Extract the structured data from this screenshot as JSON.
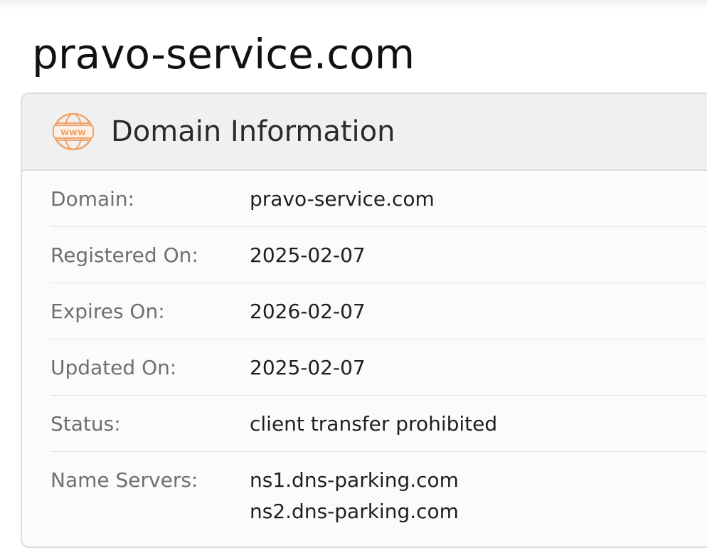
{
  "page": {
    "title": "pravo-service.com"
  },
  "card": {
    "title": "Domain Information",
    "icon": "www-globe-icon",
    "icon_text": "www",
    "accent_color": "#f0a46a"
  },
  "rows": [
    {
      "label": "Domain:",
      "value": "pravo-service.com"
    },
    {
      "label": "Registered On:",
      "value": "2025-02-07"
    },
    {
      "label": "Expires On:",
      "value": "2026-02-07"
    },
    {
      "label": "Updated On:",
      "value": "2025-02-07"
    },
    {
      "label": "Status:",
      "value": "client transfer prohibited"
    }
  ],
  "name_servers": {
    "label": "Name Servers:",
    "values": [
      "ns1.dns-parking.com",
      "ns2.dns-parking.com"
    ]
  }
}
